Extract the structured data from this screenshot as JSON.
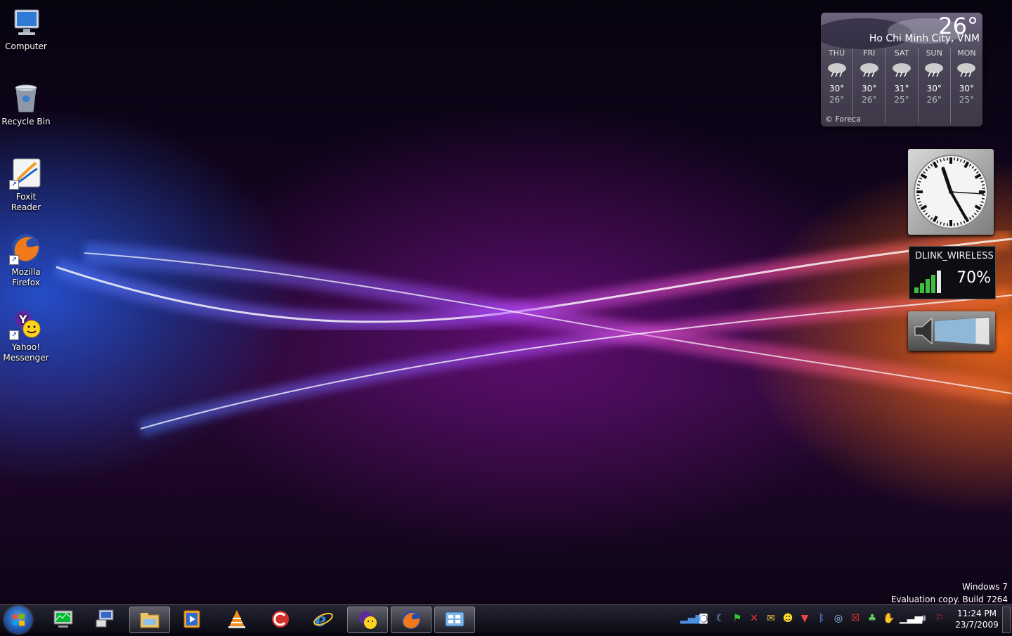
{
  "desktop_icons": [
    {
      "label": "Computer",
      "icon": "computer-icon"
    },
    {
      "label": "Recycle Bin",
      "icon": "recycle-bin-icon"
    },
    {
      "label": "Foxit Reader",
      "icon": "foxit-reader-icon"
    },
    {
      "label": "Mozilla Firefox",
      "icon": "firefox-icon"
    },
    {
      "label": "Yahoo! Messenger",
      "icon": "yahoo-messenger-icon"
    }
  ],
  "weather": {
    "temp": "26°",
    "city": "Ho Chi Minh City, VNM",
    "days": [
      {
        "name": "THU",
        "hi": "30°",
        "lo": "26°"
      },
      {
        "name": "FRI",
        "hi": "30°",
        "lo": "26°"
      },
      {
        "name": "SAT",
        "hi": "31°",
        "lo": "25°"
      },
      {
        "name": "SUN",
        "hi": "30°",
        "lo": "26°"
      },
      {
        "name": "MON",
        "hi": "30°",
        "lo": "25°"
      }
    ],
    "credit": "© Foreca"
  },
  "wifi": {
    "ssid": "DLINK_WIRELESS",
    "signal": "70%"
  },
  "volume": {
    "level_fraction": 0.75
  },
  "watermark": {
    "line1": "Windows 7",
    "line2": "Evaluation copy. Build 7264"
  },
  "taskbar": {
    "apps": [
      "task-manager-icon",
      "network-icon",
      "explorer-icon",
      "media-player-icon",
      "vlc-icon",
      "ccleaner-icon",
      "internet-explorer-icon",
      "yahoo-messenger-icon",
      "firefox-icon",
      "control-panel-icon"
    ],
    "time": "11:24 PM",
    "date": "23/7/2009"
  },
  "colors": {
    "accent": "#3d8fe8",
    "wifi_bar": "#3fbf3f"
  }
}
